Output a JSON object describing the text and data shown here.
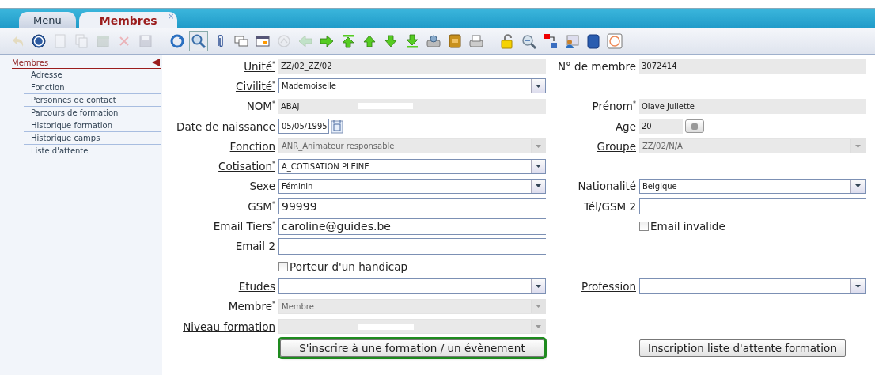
{
  "tabs": [
    {
      "label": "Menu",
      "selected": false,
      "closable": false
    },
    {
      "label": "Membres",
      "selected": true,
      "closable": true
    }
  ],
  "close_glyph": "×",
  "toolbar": [
    {
      "kind": "undo",
      "disabled": true
    },
    {
      "kind": "help",
      "disabled": false
    },
    {
      "kind": "new",
      "disabled": true
    },
    {
      "kind": "copy",
      "disabled": true
    },
    {
      "kind": "archive",
      "disabled": true
    },
    {
      "kind": "delete",
      "disabled": true
    },
    {
      "kind": "save",
      "disabled": true
    },
    {
      "kind": "sep"
    },
    {
      "kind": "refresh",
      "disabled": false
    },
    {
      "kind": "search",
      "disabled": false,
      "selected": true
    },
    {
      "kind": "attach",
      "disabled": false
    },
    {
      "kind": "comment",
      "disabled": false
    },
    {
      "kind": "table",
      "disabled": false
    },
    {
      "kind": "circle",
      "disabled": true
    },
    {
      "kind": "left",
      "disabled": true
    },
    {
      "kind": "right",
      "disabled": false
    },
    {
      "kind": "top",
      "disabled": false
    },
    {
      "kind": "up",
      "disabled": false
    },
    {
      "kind": "down",
      "disabled": false
    },
    {
      "kind": "bottom",
      "disabled": false
    },
    {
      "kind": "printgear",
      "disabled": false
    },
    {
      "kind": "book",
      "disabled": false
    },
    {
      "kind": "print",
      "disabled": false
    },
    {
      "kind": "sep"
    },
    {
      "kind": "lock",
      "disabled": false
    },
    {
      "kind": "zoomback",
      "disabled": false
    },
    {
      "kind": "export",
      "disabled": false
    },
    {
      "kind": "people",
      "disabled": false
    },
    {
      "kind": "bluebook",
      "disabled": false
    },
    {
      "kind": "logo",
      "disabled": false
    }
  ],
  "sidebar": {
    "title": "Membres",
    "items": [
      "Adresse",
      "Fonction",
      "Personnes de contact",
      "Parcours de formation",
      "Historique formation",
      "Historique camps",
      "Liste d'attente"
    ]
  },
  "rows": [
    {
      "left": {
        "label": "Unité$^{*}$",
        "link": true,
        "kind": "readonly",
        "value": "ZZ/02_ZZ/02"
      },
      "right": {
        "label": "N° de membre",
        "link": false,
        "kind": "readonly",
        "value": "3072414"
      }
    },
    {
      "left": {
        "label": "Civilité$^{*}$",
        "link": true,
        "kind": "select",
        "value": "Mademoiselle",
        "disabled": false
      }
    },
    {
      "left": {
        "label": "NOM$^{*}$",
        "link": false,
        "kind": "readonly",
        "value": "ABAJ",
        "redacted": true
      },
      "right": {
        "label": "Prénom$^{*}$",
        "link": false,
        "kind": "readonly",
        "value": "Olave Juliette"
      }
    },
    {
      "left": {
        "label": "Date de naissance",
        "link": false,
        "kind": "date",
        "value": "05/05/1995"
      },
      "right": {
        "label": "Age",
        "link": false,
        "kind": "age",
        "value": "20"
      }
    },
    {
      "left": {
        "label": "Fonction",
        "link": true,
        "kind": "select",
        "value": "ANR_Animateur responsable",
        "disabled": true
      },
      "right": {
        "label": "Groupe",
        "link": true,
        "kind": "select",
        "value": "ZZ/02/N/A",
        "disabled": true
      }
    },
    {
      "left": {
        "label": "Cotisation$^{*}$",
        "link": true,
        "kind": "select",
        "value": "A_COTISATION PLEINE",
        "disabled": false
      }
    },
    {
      "left": {
        "label": "Sexe",
        "link": false,
        "kind": "select",
        "value": "Féminin",
        "disabled": false
      },
      "right": {
        "label": "Nationalité",
        "link": true,
        "kind": "select",
        "value": "Belgique",
        "disabled": false
      }
    },
    {
      "left": {
        "label": "GSM$^{*}$",
        "link": false,
        "kind": "input",
        "value": "99999"
      },
      "right": {
        "label": "Tél/GSM 2",
        "link": false,
        "kind": "input"
      }
    },
    {
      "left": {
        "label": "Email Tiers$^{*}$",
        "link": false,
        "kind": "input",
        "value": "caroline@guides.be"
      },
      "right": {
        "kind": "checkbox",
        "text": "Email invalide",
        "checked": false
      }
    },
    {
      "left": {
        "label": "Email 2",
        "link": false,
        "kind": "input"
      }
    },
    {
      "left": {
        "kind": "checkbox",
        "text": "Porteur d'un handicap",
        "checked": false
      }
    },
    {
      "left": {
        "label": "Etudes",
        "link": true,
        "kind": "select",
        "disabled": false
      },
      "right": {
        "label": "Profession",
        "link": true,
        "kind": "select",
        "disabled": false
      }
    },
    {
      "left": {
        "label": "Membre$^{*}$",
        "link": false,
        "kind": "select",
        "value": "Membre",
        "disabled": true
      }
    },
    {
      "left": {
        "label": "Niveau formation",
        "link": true,
        "kind": "select",
        "disabled": true,
        "redacted": true
      }
    }
  ],
  "buttons": [
    {
      "label": "S'inscrire à une formation / un évènement",
      "highlighted": true
    },
    {
      "label": "Inscription liste d'attente formation",
      "highlighted": false
    }
  ]
}
